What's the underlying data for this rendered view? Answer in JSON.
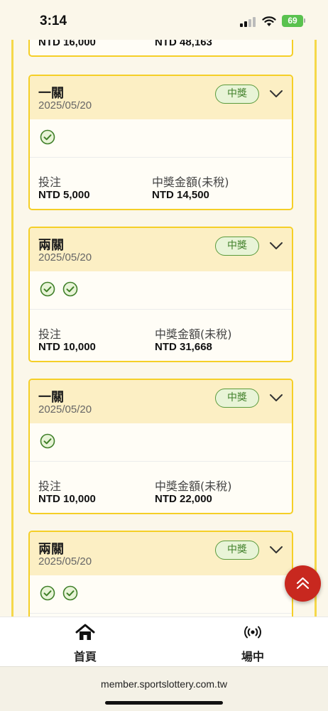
{
  "status_bar": {
    "time": "3:14",
    "battery": "69"
  },
  "top_card": {
    "bet_value": "NTD 16,000",
    "prize_value": "NTD 48,163"
  },
  "cards": [
    {
      "title": "一關",
      "date": "2025/05/20",
      "badge": "中獎",
      "checks": 1,
      "bet_label": "投注",
      "bet_value": "NTD 5,000",
      "prize_label": "中獎金額(未稅)",
      "prize_value": "NTD 14,500"
    },
    {
      "title": "兩關",
      "date": "2025/05/20",
      "badge": "中獎",
      "checks": 2,
      "bet_label": "投注",
      "bet_value": "NTD 10,000",
      "prize_label": "中獎金額(未稅)",
      "prize_value": "NTD 31,668"
    },
    {
      "title": "一關",
      "date": "2025/05/20",
      "badge": "中獎",
      "checks": 1,
      "bet_label": "投注",
      "bet_value": "NTD 10,000",
      "prize_label": "中獎金額(未稅)",
      "prize_value": "NTD 22,000"
    },
    {
      "title": "兩關",
      "date": "2025/05/20",
      "badge": "中獎",
      "checks": 2
    }
  ],
  "bottom_nav": {
    "home_label": "首頁",
    "live_label": "場中",
    "home_icon": "home-icon",
    "live_icon": "broadcast-icon"
  },
  "browser": {
    "url": "member.sportslottery.com.tw"
  },
  "colors": {
    "accent_border": "#f5cf27",
    "card_header": "#fcefc4",
    "win_green": "#3f7f28",
    "fab_red": "#c8281f"
  }
}
